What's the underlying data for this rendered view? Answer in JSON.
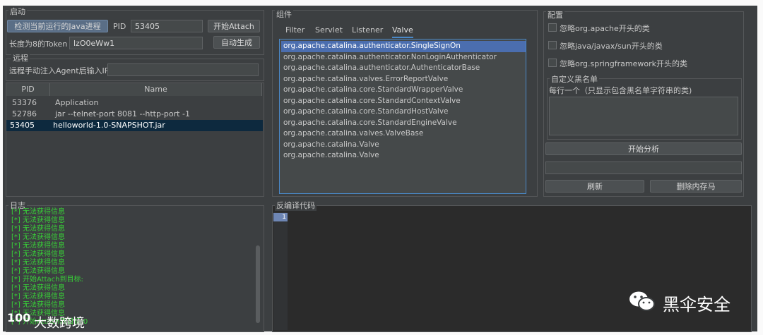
{
  "launch": {
    "title": "启动",
    "detect_button": "检测当前运行的Java进程",
    "pid_label": "PID",
    "pid_value": "53405",
    "attach_button": "开始Attach",
    "token_label": "长度为8的Token",
    "token_value": "lzO0eWw1",
    "auto_button": "自动生成"
  },
  "remote": {
    "title": "远程",
    "ip_label": "远程手动注入Agent后输入IP",
    "ip_value": ""
  },
  "process_table": {
    "columns": [
      "PID",
      "Name"
    ],
    "rows": [
      {
        "pid": "53376",
        "name": "Application"
      },
      {
        "pid": "52786",
        "name": "jar --telnet-port 8081 --http-port -1"
      },
      {
        "pid": "53405",
        "name": "helloworld-1.0-SNAPSHOT.jar"
      }
    ]
  },
  "components": {
    "title": "组件",
    "tabs": [
      "Filter",
      "Servlet",
      "Listener",
      "Valve"
    ],
    "active_tab": "Valve",
    "items": [
      "org.apache.catalina.authenticator.SingleSignOn",
      "org.apache.catalina.authenticator.NonLoginAuthenticator",
      "org.apache.catalina.authenticator.AuthenticatorBase",
      "org.apache.catalina.valves.ErrorReportValve",
      "org.apache.catalina.core.StandardWrapperValve",
      "org.apache.catalina.core.StandardContextValve",
      "org.apache.catalina.core.StandardHostValve",
      "org.apache.catalina.core.StandardEngineValve",
      "org.apache.catalina.valves.ValveBase",
      "org.apache.catalina.Valve",
      "org.apache.catalina.Valve"
    ]
  },
  "config": {
    "title": "配置",
    "options": [
      "忽略org.apache开头的类",
      "忽略java/javax/sun开头的类",
      "忽略org.springframework开头的类"
    ],
    "blacklist_title": "自定义黑名单",
    "blacklist_hint": "每行一个（只显示包含黑名单字符串的类)",
    "analyze_button": "开始分析",
    "refresh_button": "刷新",
    "delete_button": "删除内存马"
  },
  "log": {
    "title": "日志",
    "lines": [
      "[*] 无法获得信息",
      "[*] 无法获得信息",
      "[*] 无法获得信息",
      "[*] 无法获得信息",
      "[*] 无法获得信息",
      "[*] 无法获得信息",
      "[*] 无法获得信息",
      "[*] 无法获得信息",
      "[*] 开始Attach到目标:",
      "[*] 无法获得信息",
      "[*] 无法获得信息",
      "[*] 无法获得信息",
      "[*] 无法获得信息",
      "[*] 开始Attach到目标:0"
    ]
  },
  "decompile": {
    "title": "反编译代码",
    "line_number": "1"
  },
  "watermarks": {
    "left": "大数跨境",
    "right": "黑伞安全"
  },
  "colors": {
    "background": "#3c3f41",
    "selection": "#4b6eaf",
    "log_text": "#38d138"
  }
}
